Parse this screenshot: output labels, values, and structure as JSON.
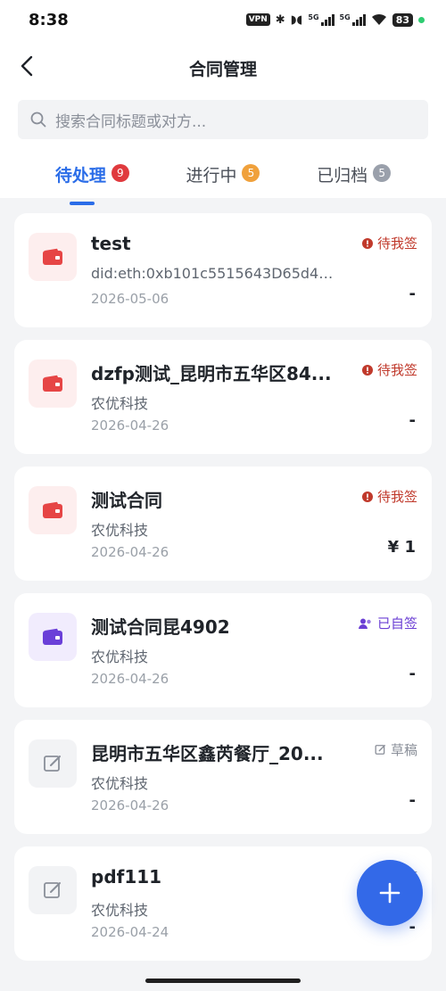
{
  "status_bar": {
    "time": "8:38",
    "vpn": "VPN",
    "net1": "5G",
    "net2": "5G",
    "battery": "83"
  },
  "header": {
    "title": "合同管理"
  },
  "search": {
    "placeholder": "搜索合同标题或对方..."
  },
  "tabs": [
    {
      "label": "待处理",
      "count": "9",
      "badge_color": "#e03a3e",
      "active": true
    },
    {
      "label": "进行中",
      "count": "5",
      "badge_color": "#f0a13c",
      "active": false
    },
    {
      "label": "已归档",
      "count": "5",
      "badge_color": "#9aa0ab",
      "active": false
    }
  ],
  "contracts": [
    {
      "title": "test",
      "subtitle": "did:eth:0xb101c5515643D65d4d...",
      "date": "2026-05-06",
      "status": "待我签",
      "status_icon": "info-icon",
      "status_color": "#c0392b",
      "amount": "-",
      "icon": "wallet-icon",
      "icon_color": "#e64545",
      "icon_bg": "#fdeeee"
    },
    {
      "title": "dzfp测试_昆明市五华区84...",
      "subtitle": "农优科技",
      "date": "2026-04-26",
      "status": "待我签",
      "status_icon": "info-icon",
      "status_color": "#c0392b",
      "amount": "-",
      "icon": "wallet-icon",
      "icon_color": "#e64545",
      "icon_bg": "#fdeeee"
    },
    {
      "title": "测试合同",
      "subtitle": "农优科技",
      "date": "2026-04-26",
      "status": "待我签",
      "status_icon": "info-icon",
      "status_color": "#c0392b",
      "amount": "¥ 1",
      "icon": "wallet-icon",
      "icon_color": "#e64545",
      "icon_bg": "#fdeeee"
    },
    {
      "title": "测试合同昆4902",
      "subtitle": "农优科技",
      "date": "2026-04-26",
      "status": "已自签",
      "status_icon": "users-icon",
      "status_color": "#6b3fd4",
      "amount": "-",
      "icon": "wallet-icon",
      "icon_color": "#6a3fd8",
      "icon_bg": "#f1ecfd"
    },
    {
      "title": "昆明市五华区鑫芮餐厅_20...",
      "subtitle": "农优科技",
      "date": "2026-04-26",
      "status": "草稿",
      "status_icon": "edit-icon",
      "status_color": "#8a8f99",
      "amount": "-",
      "icon": "edit-icon",
      "icon_color": "#8a8f99",
      "icon_bg": "#f2f3f5"
    },
    {
      "title": "pdf111",
      "subtitle": "农优科技",
      "date": "2026-04-24",
      "status": "稿",
      "status_icon": "edit-icon",
      "status_color": "#8a8f99",
      "amount": "-",
      "icon": "edit-icon",
      "icon_color": "#8a8f99",
      "icon_bg": "#f2f3f5"
    }
  ],
  "fab": {
    "icon": "plus-icon",
    "label": "+"
  }
}
